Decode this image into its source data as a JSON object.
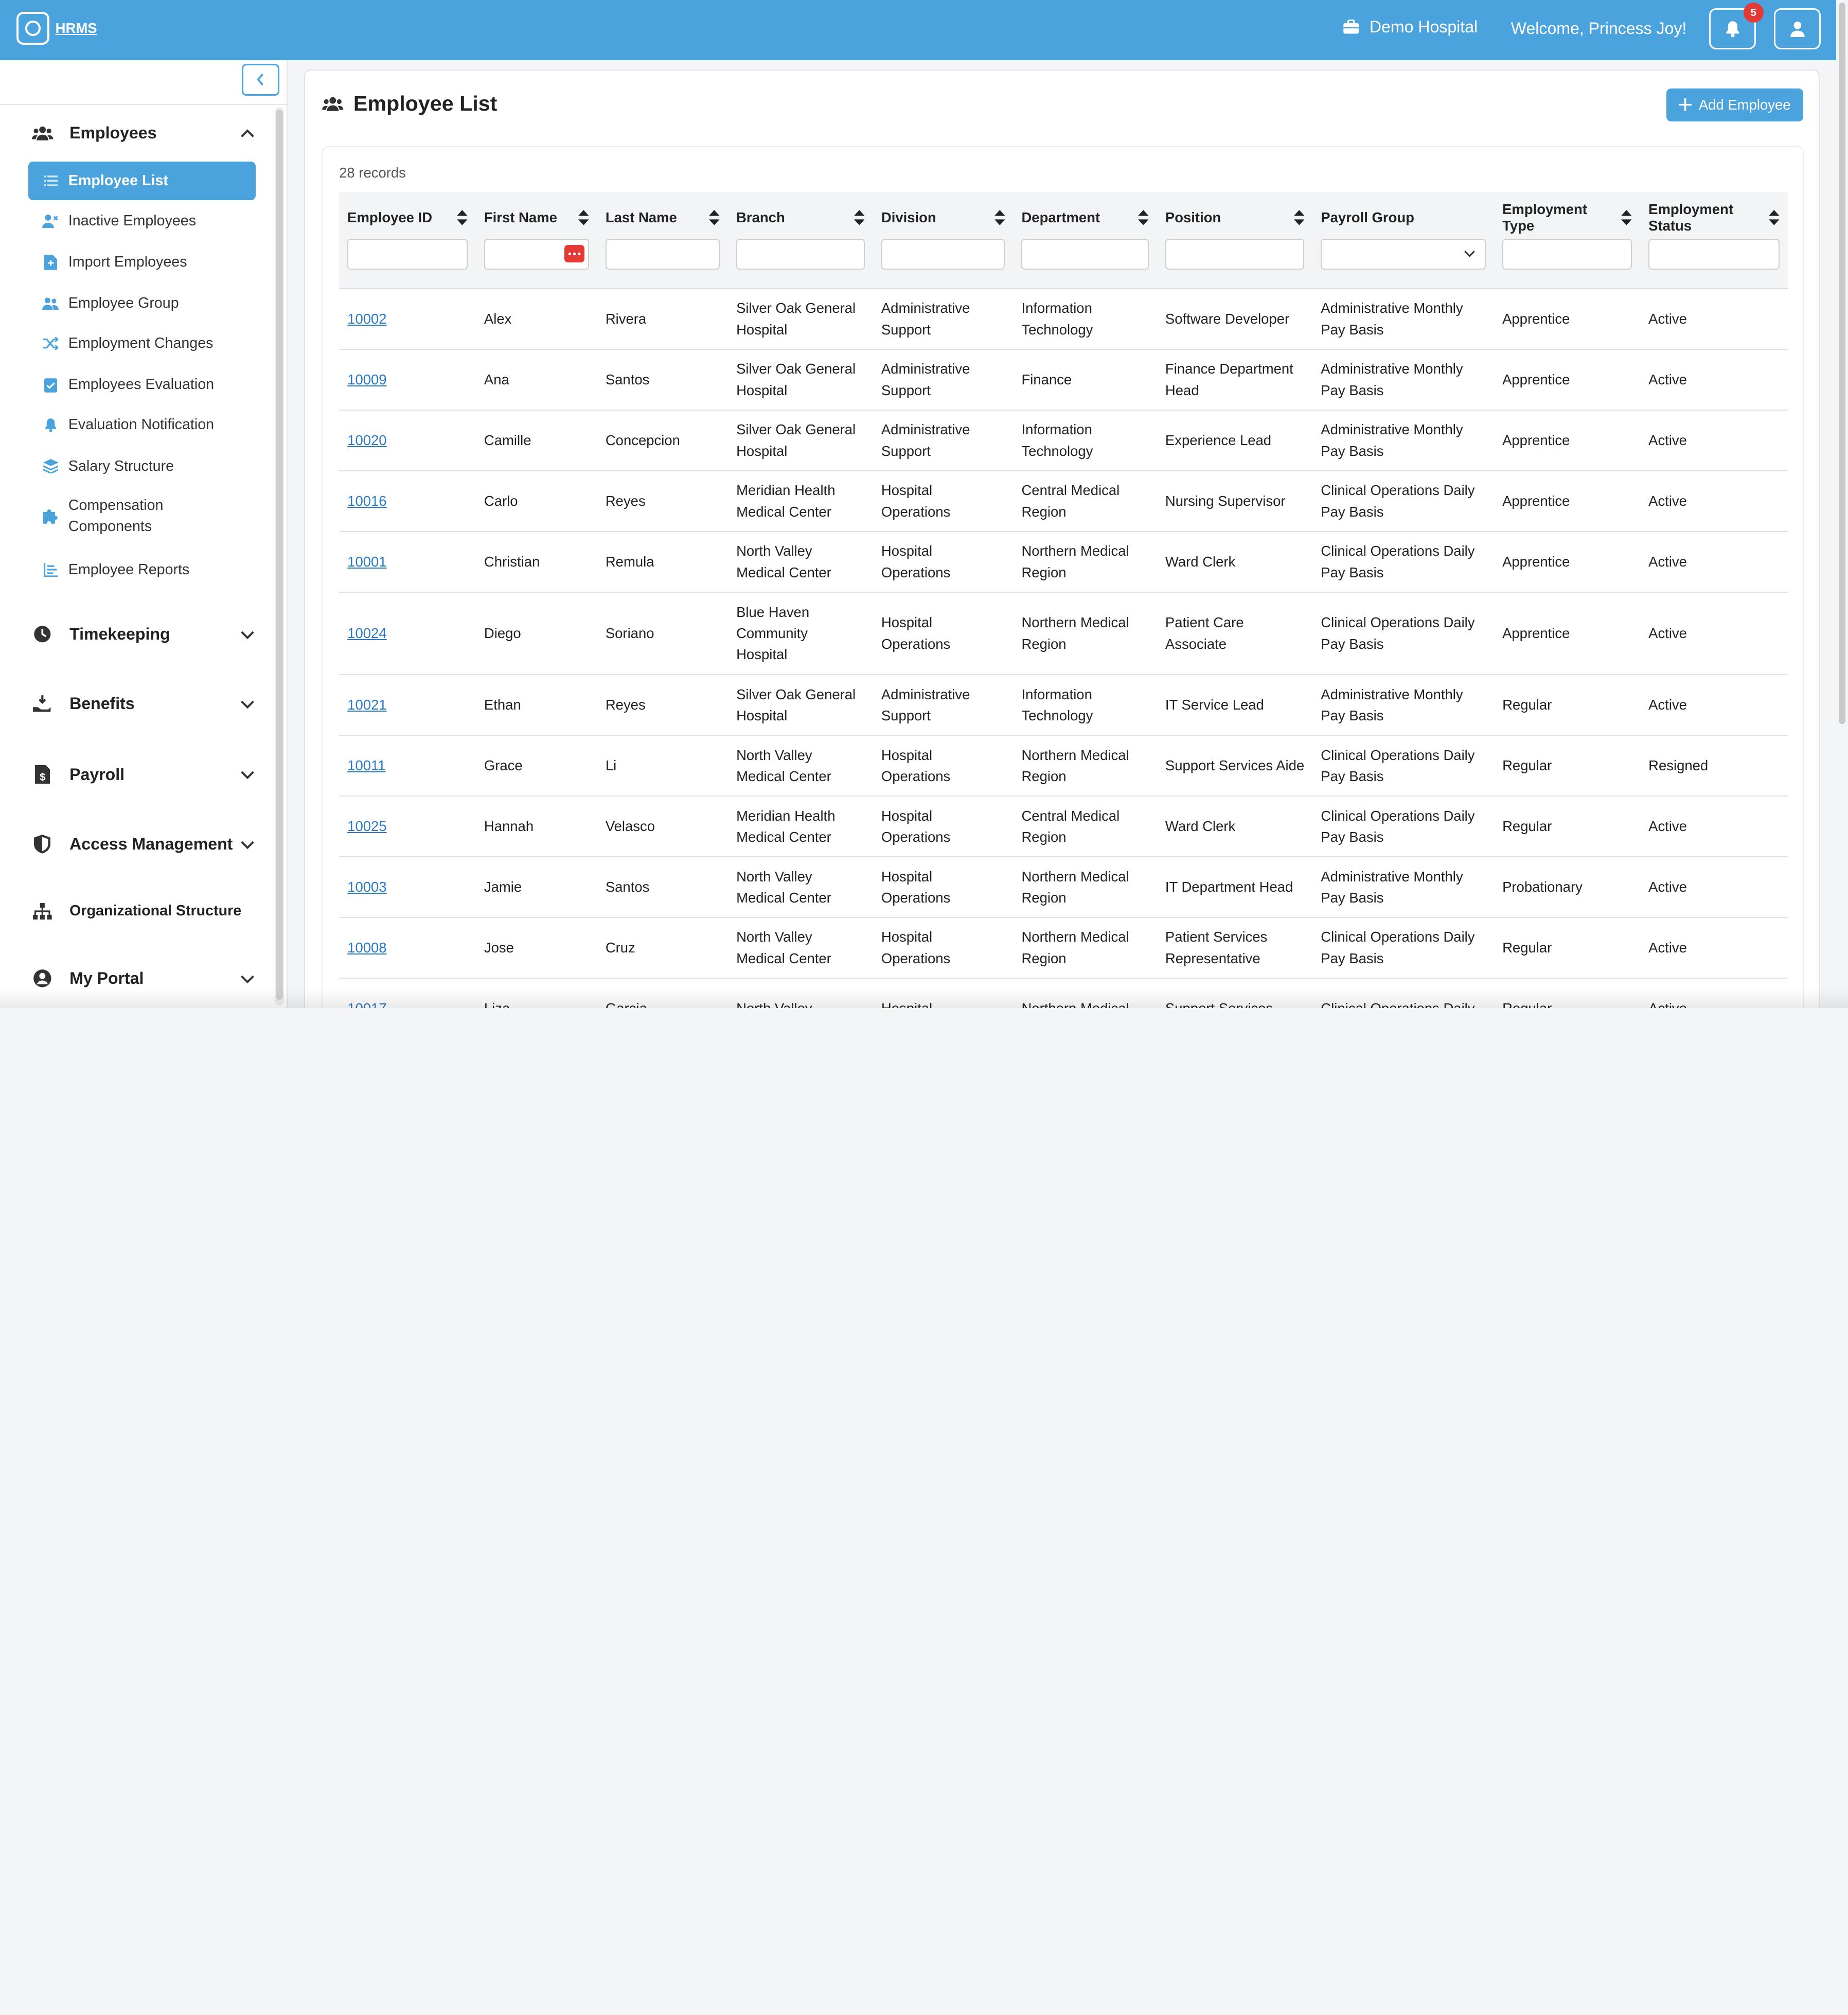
{
  "header": {
    "brand": "HRMS",
    "hospital": "Demo Hospital",
    "welcome": "Welcome, Princess Joy!",
    "notification_count": "5"
  },
  "sidebar": {
    "sections": [
      {
        "label": "Employees",
        "icon": "users-icon",
        "expanded": true
      },
      {
        "label": "Timekeeping",
        "icon": "clock-icon"
      },
      {
        "label": "Benefits",
        "icon": "hand-money-icon"
      },
      {
        "label": "Payroll",
        "icon": "document-dollar-icon"
      },
      {
        "label": "Access Management",
        "icon": "shield-icon"
      },
      {
        "label": "Organizational Structure",
        "icon": "sitemap-icon"
      },
      {
        "label": "My Portal",
        "icon": "user-circle-icon"
      }
    ],
    "items": [
      {
        "label": "Employee List",
        "icon": "list-icon",
        "active": true
      },
      {
        "label": "Inactive Employees",
        "icon": "user-x-icon"
      },
      {
        "label": "Import Employees",
        "icon": "file-import-icon"
      },
      {
        "label": "Employee Group",
        "icon": "users-icon"
      },
      {
        "label": "Employment Changes",
        "icon": "shuffle-icon"
      },
      {
        "label": "Employees Evaluation",
        "icon": "clipboard-check-icon"
      },
      {
        "label": "Evaluation Notification",
        "icon": "bell-icon"
      },
      {
        "label": "Salary Structure",
        "icon": "layers-icon"
      },
      {
        "label": "Compensation Components",
        "icon": "puzzle-icon"
      },
      {
        "label": "Employee Reports",
        "icon": "chart-list-icon"
      }
    ]
  },
  "main": {
    "title": "Employee List",
    "add_button": "Add Employee",
    "records": "28 records",
    "columns": [
      "Employee ID",
      "First Name",
      "Last Name",
      "Branch",
      "Division",
      "Department",
      "Position",
      "Payroll Group",
      "Employment Type",
      "Employment Status"
    ],
    "rows": [
      [
        "10002",
        "Alex",
        "Rivera",
        "Silver Oak General Hospital",
        "Administrative Support",
        "Information Technology",
        "Software Developer",
        "Administrative Monthly Pay Basis",
        "Apprentice",
        "Active"
      ],
      [
        "10009",
        "Ana",
        "Santos",
        "Silver Oak General Hospital",
        "Administrative Support",
        "Finance",
        "Finance Department Head",
        "Administrative Monthly Pay Basis",
        "Apprentice",
        "Active"
      ],
      [
        "10020",
        "Camille",
        "Concepcion",
        "Silver Oak General Hospital",
        "Administrative Support",
        "Information Technology",
        "Experience Lead",
        "Administrative Monthly Pay Basis",
        "Apprentice",
        "Active"
      ],
      [
        "10016",
        "Carlo",
        "Reyes",
        "Meridian Health Medical Center",
        "Hospital Operations",
        "Central Medical Region",
        "Nursing Supervisor",
        "Clinical Operations Daily Pay Basis",
        "Apprentice",
        "Active"
      ],
      [
        "10001",
        "Christian",
        "Remula",
        "North Valley Medical Center",
        "Hospital Operations",
        "Northern Medical Region",
        "Ward Clerk",
        "Clinical Operations Daily Pay Basis",
        "Apprentice",
        "Active"
      ],
      [
        "10024",
        "Diego",
        "Soriano",
        "Blue Haven Community Hospital",
        "Hospital Operations",
        "Northern Medical Region",
        "Patient Care Associate",
        "Clinical Operations Daily Pay Basis",
        "Apprentice",
        "Active"
      ],
      [
        "10021",
        "Ethan",
        "Reyes",
        "Silver Oak General Hospital",
        "Administrative Support",
        "Information Technology",
        "IT Service Lead",
        "Administrative Monthly Pay Basis",
        "Regular",
        "Active"
      ],
      [
        "10011",
        "Grace",
        "Li",
        "North Valley Medical Center",
        "Hospital Operations",
        "Northern Medical Region",
        "Support Services Aide",
        "Clinical Operations Daily Pay Basis",
        "Regular",
        "Resigned"
      ],
      [
        "10025",
        "Hannah",
        "Velasco",
        "Meridian Health Medical Center",
        "Hospital Operations",
        "Central Medical Region",
        "Ward Clerk",
        "Clinical Operations Daily Pay Basis",
        "Regular",
        "Active"
      ],
      [
        "10003",
        "Jamie",
        "Santos",
        "North Valley Medical Center",
        "Hospital Operations",
        "Northern Medical Region",
        "IT Department Head",
        "Administrative Monthly Pay Basis",
        "Probationary",
        "Active"
      ],
      [
        "10008",
        "Jose",
        "Cruz",
        "North Valley Medical Center",
        "Hospital Operations",
        "Northern Medical Region",
        "Patient Services Representative",
        "Clinical Operations Daily Pay Basis",
        "Regular",
        "Active"
      ],
      [
        "10017",
        "Liza",
        "Garcia",
        "North Valley",
        "Hospital",
        "Northern Medical",
        "Support Services",
        "Clinical Operations Daily",
        "Regular",
        "Active"
      ]
    ]
  }
}
